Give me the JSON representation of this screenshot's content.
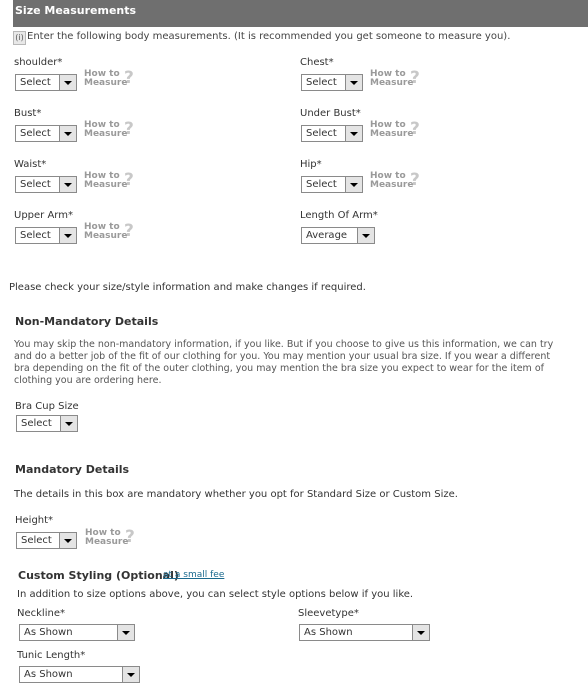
{
  "header": {
    "title": "Size Measurements"
  },
  "intro": {
    "icon": "info-icon",
    "icon_text": "(i)",
    "text": "Enter the following body measurements. (It is recommended you get someone to measure you)."
  },
  "howto": {
    "line1": "How to",
    "line2": "Measure",
    "q": "?"
  },
  "measurements": [
    {
      "label": "shoulder*",
      "value": "Select"
    },
    {
      "label": "Chest*",
      "value": "Select"
    },
    {
      "label": "Bust*",
      "value": "Select"
    },
    {
      "label": "Under Bust*",
      "value": "Select"
    },
    {
      "label": "Waist*",
      "value": "Select"
    },
    {
      "label": "Hip*",
      "value": "Select"
    },
    {
      "label": "Upper Arm*",
      "value": "Select"
    },
    {
      "label": "Length Of Arm*",
      "value": "Average"
    }
  ],
  "check_text": "Please check your size/style information and make changes if required.",
  "non_mandatory": {
    "title": "Non-Mandatory Details",
    "para_lines": [
      "You may skip the non-mandatory information, if you like. But if you choose to give us this information, we can try",
      "and do a better job of the fit of our clothing for you. You may mention your usual bra size. If you wear a different",
      "bra depending on the fit of the outer clothing, you may mention the bra size you expect to wear for the item of",
      "clothing you are ordering here."
    ],
    "bra_label": "Bra Cup Size",
    "bra_value": "Select"
  },
  "mandatory": {
    "title": "Mandatory Details",
    "para": "The details in this box are mandatory whether you opt for Standard Size or Custom Size.",
    "height_label": "Height*",
    "height_value": "Select"
  },
  "custom": {
    "title": "Custom Styling (Optional)",
    "link": "at a small fee",
    "para": "In addition to size options above, you can select style options below if you like.",
    "neckline_label": "Neckline*",
    "neckline_value": "As Shown",
    "sleeve_label": "Sleevetype*",
    "sleeve_value": "As Shown",
    "tunic_label": "Tunic Length*",
    "tunic_value": "As Shown"
  }
}
